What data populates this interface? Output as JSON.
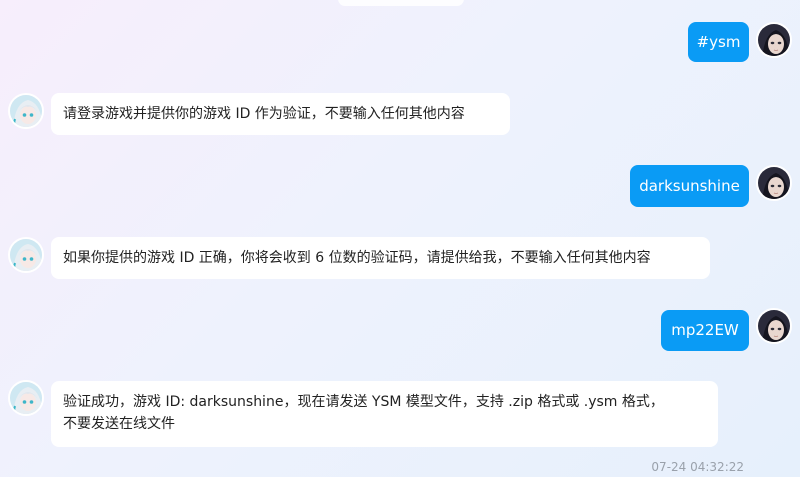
{
  "messages": [
    {
      "side": "right",
      "text": "#ysm"
    },
    {
      "side": "left",
      "text": "请登录游戏并提供你的游戏 ID 作为验证，不要输入任何其他内容"
    },
    {
      "side": "right",
      "text": "darksunshine"
    },
    {
      "side": "left",
      "text": "如果你提供的游戏 ID 正确，你将会收到 6 位数的验证码，请提供给我，不要输入任何其他内容"
    },
    {
      "side": "right",
      "text": "mp22EW"
    },
    {
      "side": "left",
      "line1": "验证成功，游戏 ID: darksunshine，现在请发送 YSM 模型文件，支持 .zip 格式或 .ysm 格式，",
      "line2": "不要发送在线文件"
    }
  ],
  "timestamp": "07-24 04:32:22",
  "colors": {
    "outgoing_bubble": "#0a9bf5",
    "incoming_bubble": "#ffffff",
    "text_dark": "#222222",
    "timestamp": "#9aa1ab"
  },
  "icons": {
    "user_avatar": "dark-haired-avatar-icon",
    "bot_avatar": "anime-girl-avatar-icon"
  }
}
